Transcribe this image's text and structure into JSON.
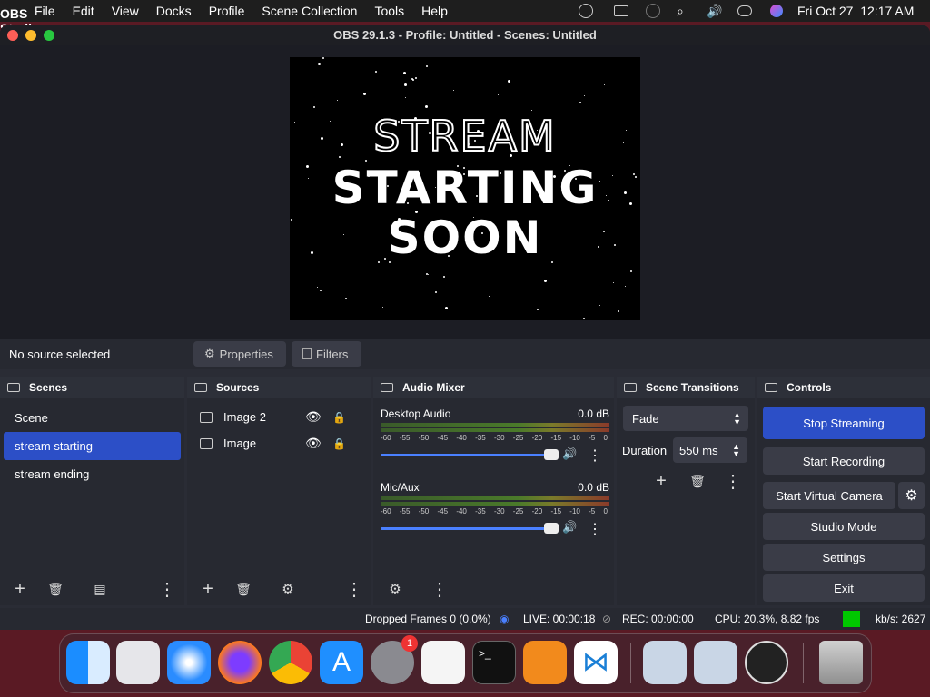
{
  "menubar": {
    "app_name": "OBS Studio",
    "items": [
      "File",
      "Edit",
      "View",
      "Docks",
      "Profile",
      "Scene Collection",
      "Tools",
      "Help"
    ],
    "clock": "Fri Oct 27  12:17 AM"
  },
  "window": {
    "title": "OBS 29.1.3 - Profile: Untitled - Scenes: Untitled"
  },
  "preview": {
    "line1": "STREAM",
    "line2": "STARTING",
    "line3": "SOON"
  },
  "source_bar": {
    "status": "No source selected",
    "properties": "Properties",
    "filters": "Filters"
  },
  "scenes": {
    "title": "Scenes",
    "items": [
      "Scene",
      "stream starting",
      "stream ending"
    ],
    "selected": "stream starting"
  },
  "sources": {
    "title": "Sources",
    "items": [
      "Image 2",
      "Image"
    ]
  },
  "audio": {
    "title": "Audio Mixer",
    "channels": [
      {
        "name": "Desktop Audio",
        "db": "0.0 dB"
      },
      {
        "name": "Mic/Aux",
        "db": "0.0 dB"
      }
    ],
    "ticks": [
      "-60",
      "-55",
      "-50",
      "-45",
      "-40",
      "-35",
      "-30",
      "-25",
      "-20",
      "-15",
      "-10",
      "-5",
      "0"
    ]
  },
  "transitions": {
    "title": "Scene Transitions",
    "type": "Fade",
    "duration_label": "Duration",
    "duration_value": "550 ms"
  },
  "controls": {
    "title": "Controls",
    "stop_streaming": "Stop Streaming",
    "start_recording": "Start Recording",
    "start_virtual_camera": "Start Virtual Camera",
    "studio_mode": "Studio Mode",
    "settings": "Settings",
    "exit": "Exit"
  },
  "status": {
    "dropped": "Dropped Frames 0 (0.0%)",
    "live": "LIVE: 00:00:18",
    "rec": "REC: 00:00:00",
    "cpu": "CPU: 20.3%, 8.82 fps",
    "kbs": "kb/s: 2627"
  },
  "dock": {
    "settings_badge": "1"
  },
  "colors": {
    "accent": "#2c4fc7",
    "stream_active": "#00c800"
  }
}
